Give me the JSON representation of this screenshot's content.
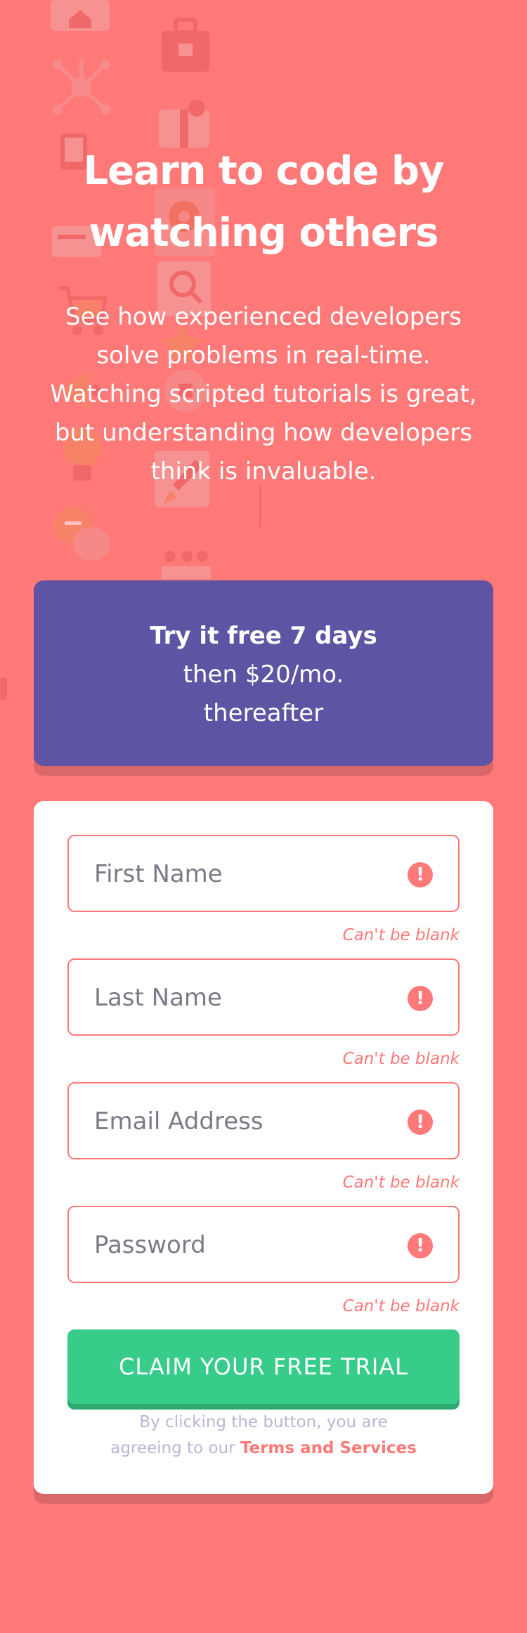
{
  "colors": {
    "background": "#ff7979",
    "promo_background": "#5e54a4",
    "card_background": "#ffffff",
    "error": "#ff7979",
    "button": "#38cc8b",
    "terms_text": "#b9b6d3"
  },
  "hero": {
    "title_line1": "Learn to code by",
    "title_line2": "watching others",
    "text_line1": "See how experienced developers",
    "text_line2": "solve problems in real-time.",
    "text_line3": "Watching scripted tutorials is great,",
    "text_line4": "but understanding how developers",
    "text_line5": "think is invaluable."
  },
  "promo": {
    "bold": "Try it free 7 days",
    "line2": "then $20/mo.",
    "line3": "thereafter"
  },
  "form": {
    "fields": [
      {
        "placeholder": "First Name",
        "error": "Can't be blank",
        "icon": "error-icon"
      },
      {
        "placeholder": "Last Name",
        "error": "Can't be blank",
        "icon": "error-icon"
      },
      {
        "placeholder": "Email Address",
        "error": "Can't be blank",
        "icon": "error-icon"
      },
      {
        "placeholder": "Password",
        "error": "Can't be blank",
        "icon": "error-icon"
      }
    ],
    "error_icon_glyph": "!",
    "submit_label": "CLAIM YOUR FREE TRIAL",
    "terms_line1": "By clicking the button, you are",
    "terms_prefix": "agreeing to our ",
    "terms_link": "Terms and Services"
  }
}
